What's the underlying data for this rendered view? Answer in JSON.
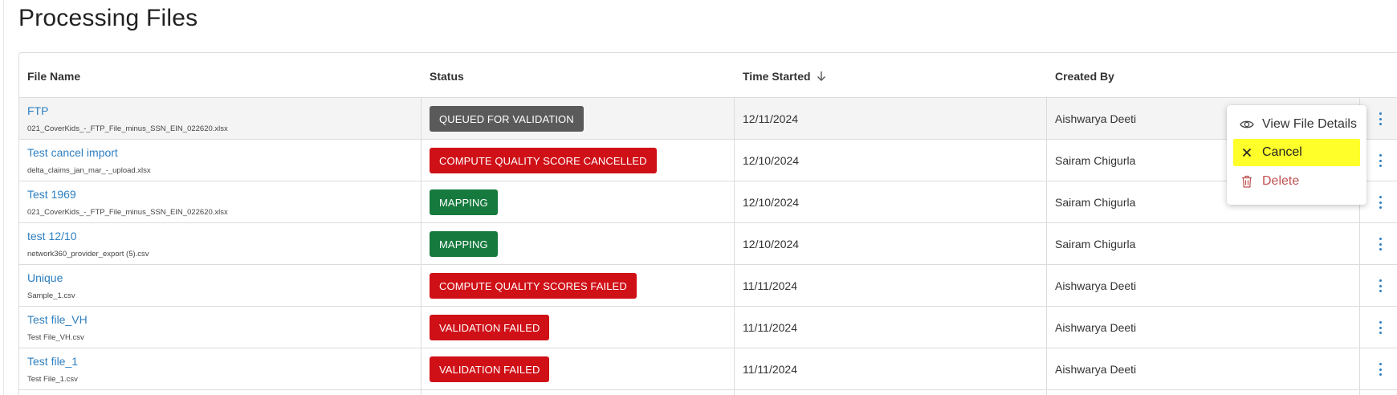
{
  "page": {
    "title": "Processing Files"
  },
  "table": {
    "columns": {
      "file_name": "File Name",
      "status": "Status",
      "time_started": "Time Started",
      "created_by": "Created By"
    },
    "rows": [
      {
        "name": "FTP",
        "file": "021_CoverKids_-_FTP_File_minus_SSN_EIN_022620.xlsx",
        "status": "QUEUED FOR VALIDATION",
        "status_color": "#5a5a5a",
        "time": "12/11/2024",
        "created_by": "Aishwarya Deeti"
      },
      {
        "name": "Test cancel import",
        "file": "delta_claims_jan_mar_-_upload.xlsx",
        "status": "COMPUTE QUALITY SCORE CANCELLED",
        "status_color": "#d01017",
        "time": "12/10/2024",
        "created_by": "Sairam Chigurla"
      },
      {
        "name": "Test 1969",
        "file": "021_CoverKids_-_FTP_File_minus_SSN_EIN_022620.xlsx",
        "status": "MAPPING",
        "status_color": "#167a3e",
        "time": "12/10/2024",
        "created_by": "Sairam Chigurla"
      },
      {
        "name": "test 12/10",
        "file": "network360_provider_export (5).csv",
        "status": "MAPPING",
        "status_color": "#167a3e",
        "time": "12/10/2024",
        "created_by": "Sairam Chigurla"
      },
      {
        "name": "Unique",
        "file": "Sample_1.csv",
        "status": "COMPUTE QUALITY SCORES FAILED",
        "status_color": "#d01017",
        "time": "11/11/2024",
        "created_by": "Aishwarya Deeti"
      },
      {
        "name": "Test file_VH",
        "file": "Test File_VH.csv",
        "status": "VALIDATION FAILED",
        "status_color": "#d01017",
        "time": "11/11/2024",
        "created_by": "Aishwarya Deeti"
      },
      {
        "name": "Test file_1",
        "file": "Test File_1.csv",
        "status": "VALIDATION FAILED",
        "status_color": "#d01017",
        "time": "11/11/2024",
        "created_by": "Aishwarya Deeti"
      }
    ]
  },
  "menu": {
    "view_label": "View File Details",
    "cancel_label": "Cancel",
    "delete_label": "Delete",
    "icons": {
      "view": "eye-icon",
      "cancel": "x-icon",
      "delete": "trash-icon"
    }
  },
  "colors": {
    "link": "#2d7fc1",
    "highlight": "#ffff2a",
    "delete": "#c05050"
  }
}
